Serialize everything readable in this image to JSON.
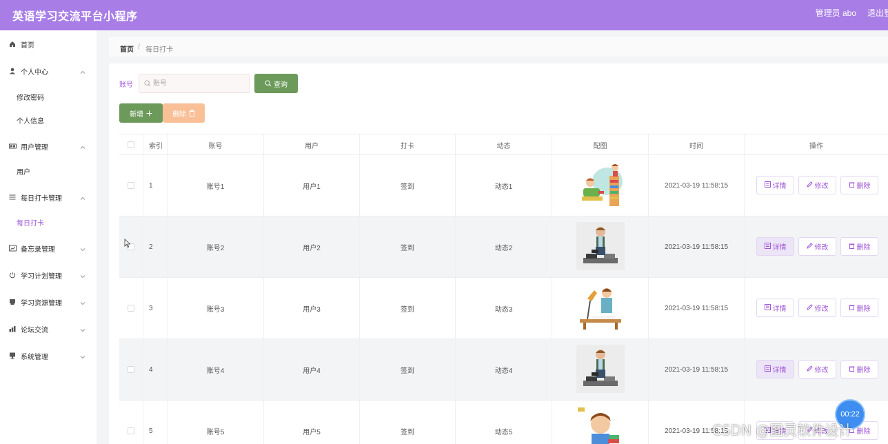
{
  "header": {
    "app_title": "英语学习交流平台小程序",
    "admin": "管理员 abo",
    "logout": "退出登"
  },
  "sidebar": {
    "items": [
      {
        "label": "首页",
        "icon": "home-icon",
        "sub": false,
        "chevron": false
      },
      {
        "label": "个人中心",
        "icon": "user-icon",
        "sub": false,
        "chevron": "up"
      },
      {
        "label": "修改密码",
        "sub": true
      },
      {
        "label": "个人信息",
        "sub": true
      },
      {
        "label": "用户管理",
        "icon": "users-icon",
        "sub": false,
        "chevron": "up"
      },
      {
        "label": "用户",
        "sub": true
      },
      {
        "label": "每日打卡管理",
        "icon": "list-icon",
        "sub": false,
        "chevron": "up"
      },
      {
        "label": "每日打卡",
        "sub": true,
        "active": true
      },
      {
        "label": "备忘录管理",
        "icon": "memo-icon",
        "sub": false,
        "chevron": "down"
      },
      {
        "label": "学习计划管理",
        "icon": "power-icon",
        "sub": false,
        "chevron": "down"
      },
      {
        "label": "学习资源管理",
        "icon": "book-icon",
        "sub": false,
        "chevron": "down"
      },
      {
        "label": "论坛交流",
        "icon": "chart-icon",
        "sub": false,
        "chevron": "down"
      },
      {
        "label": "系统管理",
        "icon": "monitor-icon",
        "sub": false,
        "chevron": "down"
      }
    ]
  },
  "breadcrumb": {
    "home": "首页",
    "sep": "/",
    "current": "每日打卡"
  },
  "search": {
    "label": "账号",
    "placeholder": "账号",
    "query_button": "查询"
  },
  "toolbar": {
    "add": "新增",
    "delete": "删除"
  },
  "table": {
    "headers": [
      "索引",
      "账号",
      "用户",
      "打卡",
      "动态",
      "配图",
      "时间",
      "操作"
    ],
    "rows": [
      {
        "index": "1",
        "account": "账号1",
        "user": "用户1",
        "checkin": "签到",
        "status": "动态1",
        "image": "kids-reading-illustration",
        "time": "2021-03-19 11:58:15"
      },
      {
        "index": "2",
        "account": "账号2",
        "user": "用户2",
        "checkin": "签到",
        "status": "动态2",
        "image": "man-sitting-on-books-illustration",
        "time": "2021-03-19 11:58:15"
      },
      {
        "index": "3",
        "account": "账号3",
        "user": "用户3",
        "checkin": "签到",
        "status": "动态3",
        "image": "student-at-desk-illustration",
        "time": "2021-03-19 11:58:15"
      },
      {
        "index": "4",
        "account": "账号4",
        "user": "用户4",
        "checkin": "签到",
        "status": "动态4",
        "image": "man-sitting-on-books-illustration",
        "time": "2021-03-19 11:58:15"
      },
      {
        "index": "5",
        "account": "账号5",
        "user": "用户5",
        "checkin": "签到",
        "status": "动态5",
        "image": "boy-with-books-illustration",
        "time": "2021-03-19 11:58:15"
      }
    ],
    "actions": {
      "detail": "详情",
      "edit": "修改",
      "delete": "删除"
    }
  },
  "overlay": {
    "timer": "00:22",
    "watermark": "CSDN @图灵软件设计"
  },
  "colors": {
    "header": "#a87de6",
    "accent": "#a057d8",
    "primary_button": "#6c9a5b",
    "delete_button": "#f9bf97"
  }
}
